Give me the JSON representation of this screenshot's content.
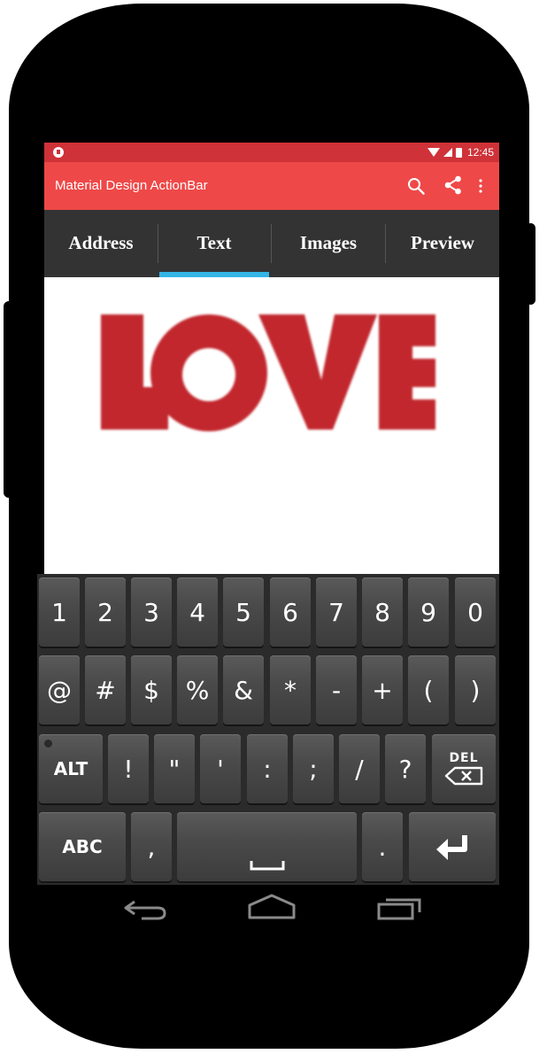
{
  "status_bar": {
    "time": "12:45"
  },
  "action_bar": {
    "title": "Material Design ActionBar"
  },
  "tabs": [
    {
      "label": "Address"
    },
    {
      "label": "Text"
    },
    {
      "label": "Images"
    },
    {
      "label": "Preview"
    }
  ],
  "selected_tab": "Text",
  "content": {
    "logo_text": "LOVE"
  },
  "keyboard": {
    "row1": [
      "1",
      "2",
      "3",
      "4",
      "5",
      "6",
      "7",
      "8",
      "9",
      "0"
    ],
    "row2": [
      "@",
      "#",
      "$",
      "%",
      "&",
      "*",
      "-",
      "+",
      "(",
      ")"
    ],
    "row3": [
      "!",
      "\"",
      "'",
      ":",
      ";",
      "/",
      "?"
    ],
    "alt_label": "ALT",
    "del_label": "DEL",
    "abc_label": "ABC",
    "comma": ",",
    "period": "."
  },
  "colors": {
    "status_bar": "#cf3238",
    "action_bar": "#ef4848",
    "tab_bar": "#333333",
    "tab_indicator": "#33b5e5",
    "logo": "#c1272d"
  },
  "icons": [
    "search-icon",
    "share-icon",
    "overflow-menu-icon",
    "back-icon",
    "home-icon",
    "recents-icon",
    "backspace-icon",
    "enter-icon",
    "space-icon"
  ]
}
